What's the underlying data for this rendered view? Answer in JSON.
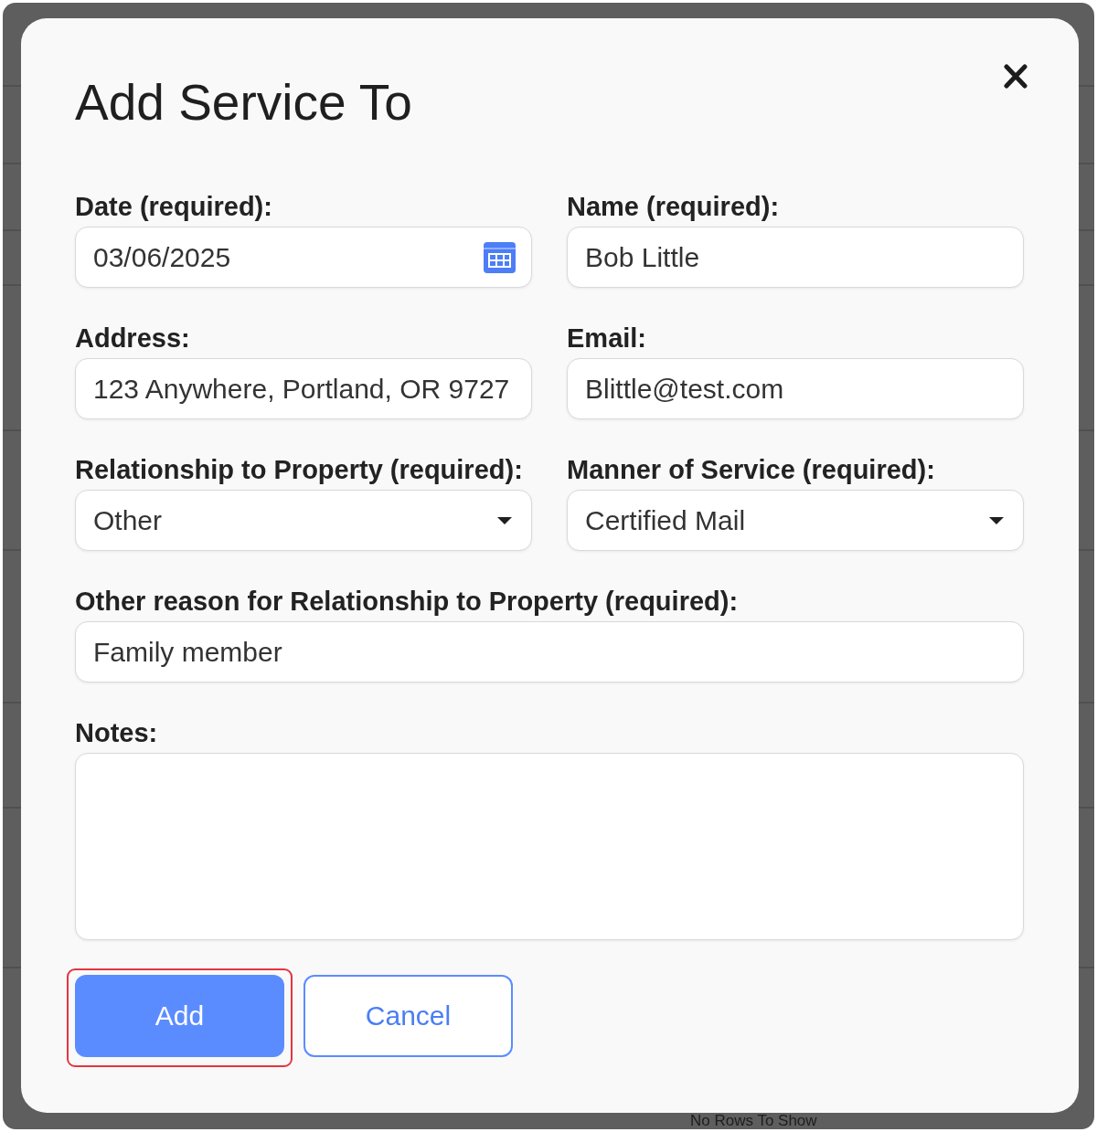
{
  "backdrop": {
    "empty_message": "No Rows To Show"
  },
  "dialog": {
    "title": "Add Service To",
    "rows": [
      [
        {
          "kind": "date",
          "label": "Date (required):",
          "value": "03/06/2025"
        },
        {
          "kind": "text",
          "label": "Name (required):",
          "value": "Bob Little"
        }
      ],
      [
        {
          "kind": "text",
          "label": "Address:",
          "value": "123 Anywhere, Portland, OR 9727"
        },
        {
          "kind": "text",
          "label": "Email:",
          "value": "Blittle@test.com"
        }
      ],
      [
        {
          "kind": "select",
          "label": "Relationship to Property (required):",
          "value": "Other"
        },
        {
          "kind": "select",
          "label": "Manner of Service (required):",
          "value": "Certified Mail"
        }
      ],
      [
        {
          "kind": "text",
          "label": "Other reason for Relationship to Property (required):",
          "value": "Family member"
        }
      ],
      [
        {
          "kind": "textarea",
          "label": "Notes:"
        }
      ]
    ],
    "buttons": [
      {
        "kind": "primary",
        "label": "Add",
        "highlighted": true
      },
      {
        "kind": "secondary",
        "label": "Cancel",
        "highlighted": false
      }
    ]
  }
}
